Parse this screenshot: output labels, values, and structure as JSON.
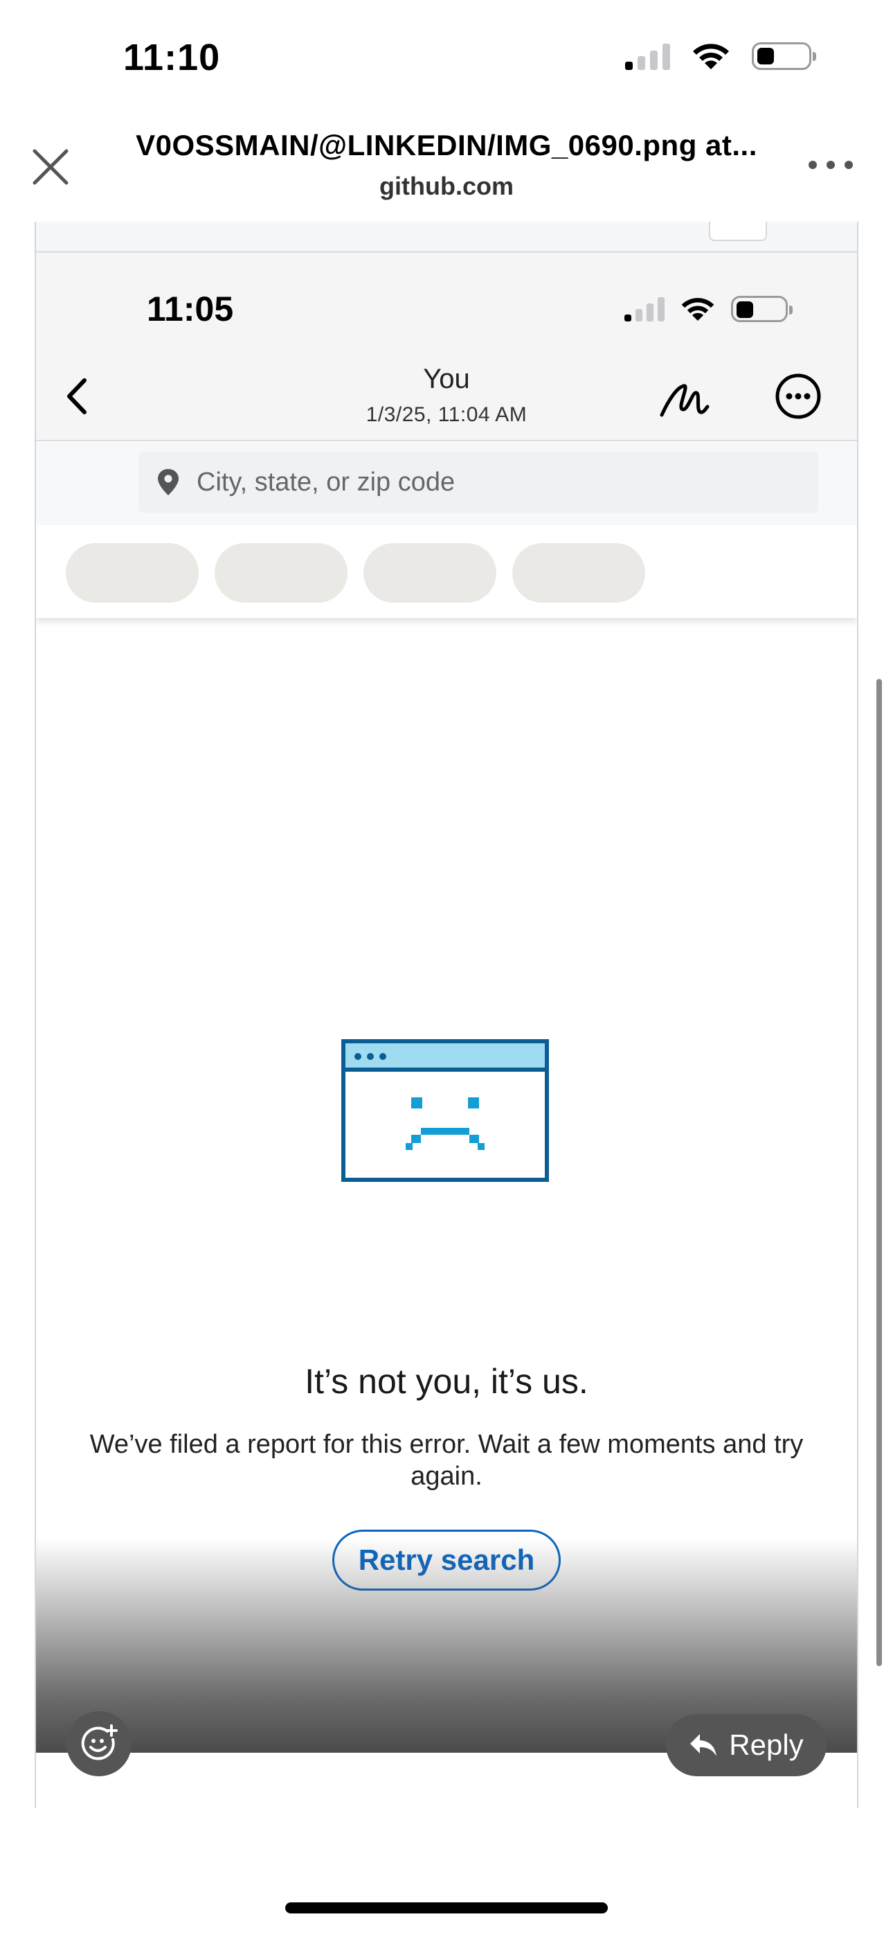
{
  "status_bar": {
    "time": "11:10",
    "icons": [
      "cellular-signal-icon",
      "wifi-icon",
      "battery-icon"
    ]
  },
  "browser": {
    "page_title": "V0OSSMAIN/@LINKEDIN/IMG_0690.png at...",
    "domain": "github.com",
    "icons": [
      "close-icon",
      "more-dots-icon"
    ]
  },
  "screenshot": {
    "status_bar": {
      "time": "11:05"
    },
    "nav": {
      "title": "You",
      "subtitle": "1/3/25, 11:04 AM",
      "icons": [
        "back-chevron-icon",
        "markup-pen-icon",
        "more-circle-icon"
      ]
    },
    "search": {
      "placeholder": "City, state, or zip code",
      "icon": "location-pin-icon"
    },
    "filter_pills_count": 4,
    "error": {
      "title": "It’s not you, it’s us.",
      "body": "We’ve filed a report for this error. Wait a few moments and try again.",
      "retry_label": "Retry search",
      "icon": "sad-browser-window-icon"
    },
    "actions": {
      "reply_label": "Reply",
      "emoji_icon": "add-emoji-icon",
      "reply_icon": "reply-arrow-icon"
    }
  },
  "colors": {
    "accent": "#0a66c2",
    "illustration_dark": "#0b5e94",
    "illustration_light": "#9fdcf2",
    "illustration_face": "#139ed6",
    "pill": "#ebe9e6"
  }
}
